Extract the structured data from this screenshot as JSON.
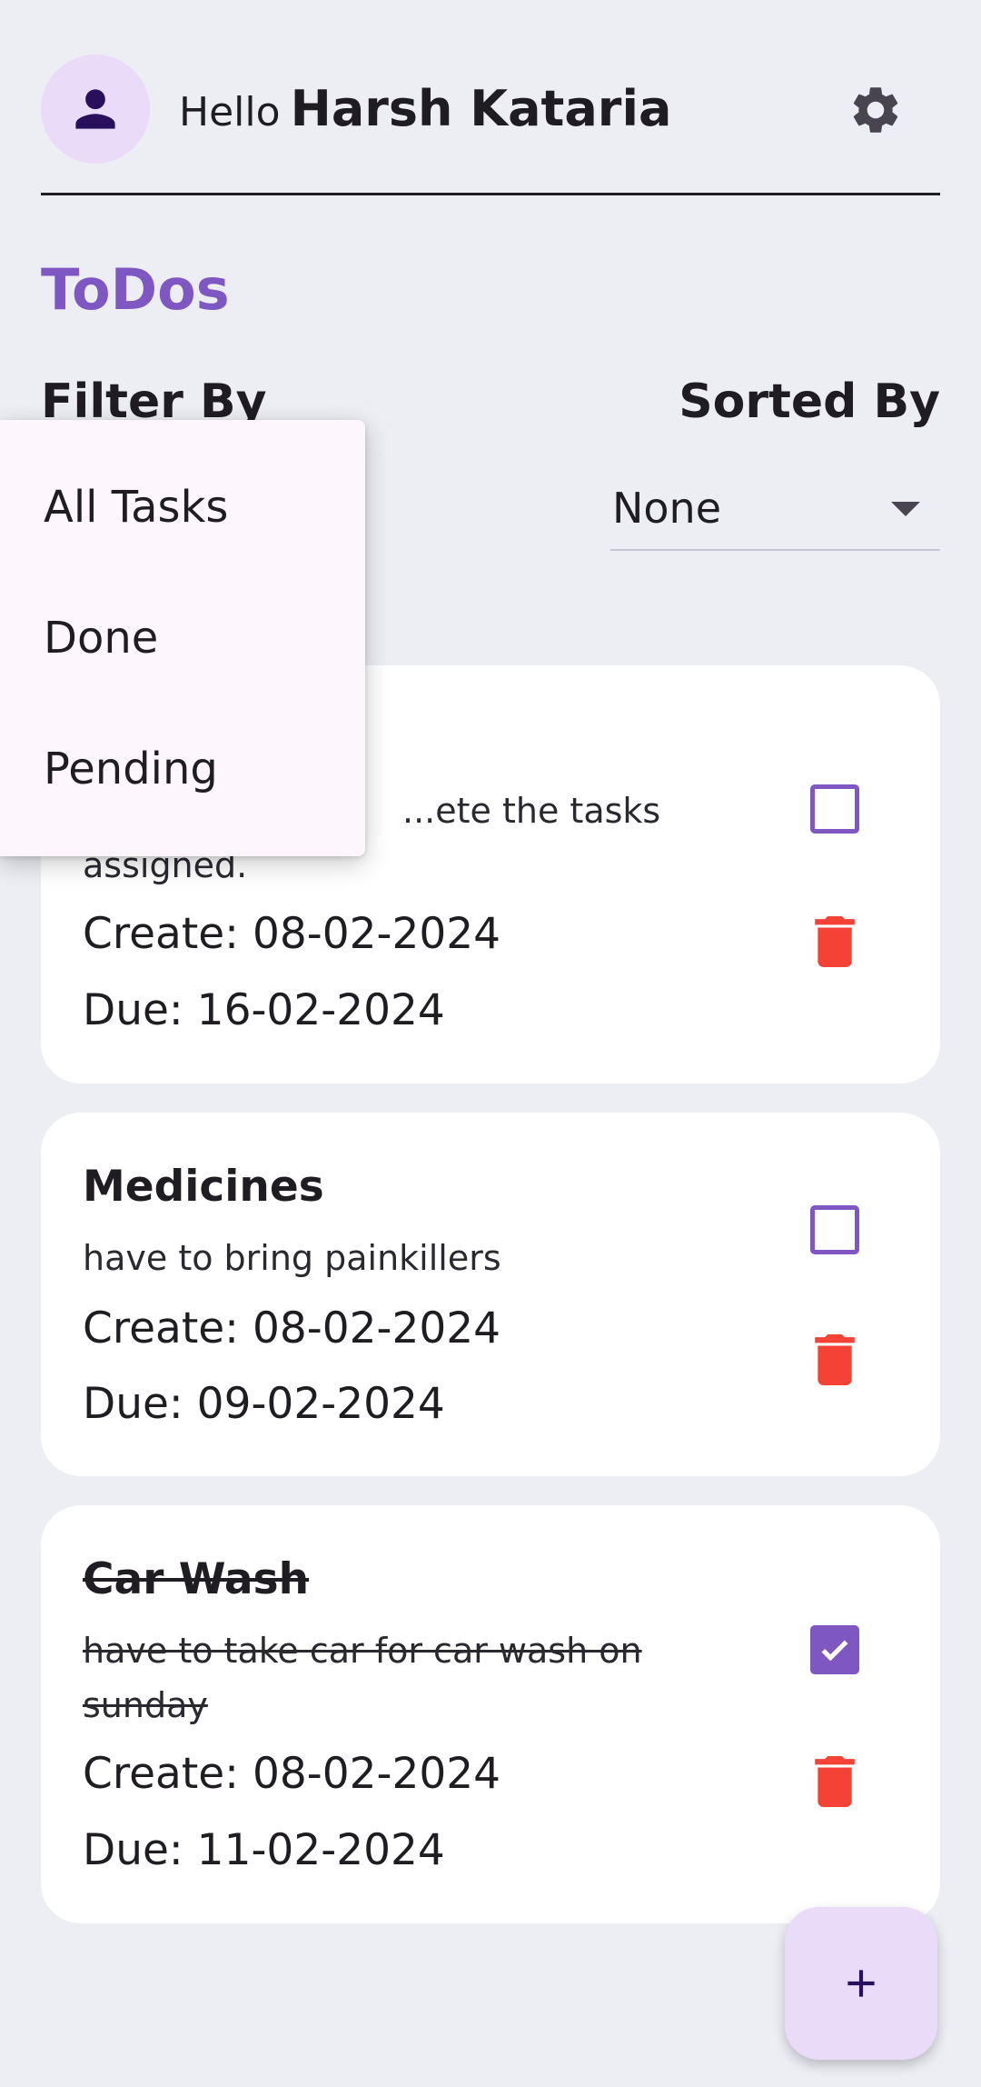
{
  "header": {
    "greeting": "Hello",
    "user_name": "Harsh Kataria"
  },
  "page_title": "ToDos",
  "filter": {
    "label": "Filter By",
    "options": [
      "All Tasks",
      "Done",
      "Pending"
    ]
  },
  "sort": {
    "label": "Sorted By",
    "selected": "None"
  },
  "todos": [
    {
      "title": "",
      "description_line1": "...ete the tasks",
      "description_line2": "assigned.",
      "created": "Create: 08-02-2024",
      "due": "Due: 16-02-2024",
      "done": false
    },
    {
      "title": "Medicines",
      "description_line1": "have to bring painkillers",
      "description_line2": "",
      "created": "Create: 08-02-2024",
      "due": "Due: 09-02-2024",
      "done": false
    },
    {
      "title": "Car Wash",
      "description_line1": "have to take car for car wash on",
      "description_line2": "sunday",
      "created": "Create: 08-02-2024",
      "due": "Due: 11-02-2024",
      "done": true
    }
  ],
  "icons": {
    "avatar": "person-icon",
    "settings": "gear-icon",
    "checkbox": "checkbox-icon",
    "delete": "trash-icon",
    "fab": "plus-icon"
  },
  "colors": {
    "accent": "#7e57c2",
    "delete": "#f44336",
    "avatar_bg": "#eadcf9",
    "background": "#edeef4"
  }
}
